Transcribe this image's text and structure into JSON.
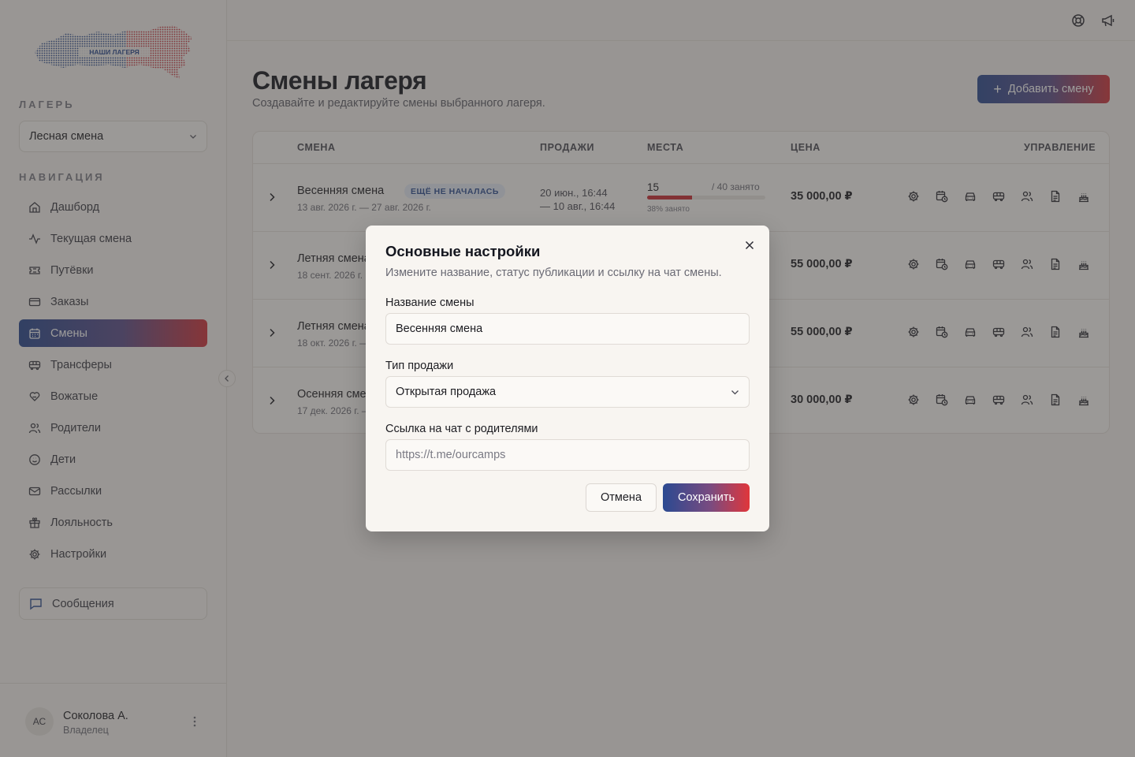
{
  "sidebar": {
    "logo_text": "НАШИ ЛАГЕРЯ",
    "camp_label": "ЛАГЕРЬ",
    "camp_value": "Лесная смена",
    "nav_label": "НАВИГАЦИЯ",
    "items": [
      {
        "label": "Дашборд",
        "icon": "home-icon"
      },
      {
        "label": "Текущая смена",
        "icon": "activity-icon"
      },
      {
        "label": "Путёвки",
        "icon": "ticket-icon"
      },
      {
        "label": "Заказы",
        "icon": "card-icon"
      },
      {
        "label": "Смены",
        "icon": "calendar-icon"
      },
      {
        "label": "Трансферы",
        "icon": "bus-icon"
      },
      {
        "label": "Вожатые",
        "icon": "heart-hand-icon"
      },
      {
        "label": "Родители",
        "icon": "users-icon"
      },
      {
        "label": "Дети",
        "icon": "smile-icon"
      },
      {
        "label": "Рассылки",
        "icon": "mail-icon"
      },
      {
        "label": "Лояльность",
        "icon": "gift-icon"
      },
      {
        "label": "Настройки",
        "icon": "gear-icon"
      }
    ],
    "active_index": 4,
    "messages_label": "Сообщения",
    "user": {
      "initials": "АС",
      "name": "Соколова А.",
      "role": "Владелец"
    }
  },
  "header": {
    "title": "Смены лагеря",
    "subtitle": "Создавайте и редактируйте смены выбранного лагеря.",
    "add_button": "Добавить смену"
  },
  "table": {
    "columns": [
      "СМЕНА",
      "ПРОДАЖИ",
      "МЕСТА",
      "ЦЕНА",
      "УПРАВЛЕНИЕ"
    ],
    "rows": [
      {
        "name": "Весенняя смена",
        "badge": "ЕЩЁ НЕ НАЧАЛАСЬ",
        "dates": "13 авг. 2026 г. — 27 авг. 2026 г.",
        "sales_from": "20 июн., 16:44",
        "sales_to": "— 10 авг., 16:44",
        "seats_taken": "15",
        "seats_total": "/ 40 занято",
        "seats_percent": "38% занято",
        "fill": 0.38,
        "price": "35 000,00 ₽"
      },
      {
        "name": "Летняя смена",
        "dates": "18 сент. 2026 г.",
        "price": "55 000,00 ₽"
      },
      {
        "name": "Летняя смена",
        "dates": "18 окт. 2026 г. —",
        "price": "55 000,00 ₽"
      },
      {
        "name": "Осенняя смена",
        "dates": "17 дек. 2026 г. —",
        "price": "30 000,00 ₽"
      }
    ]
  },
  "modal": {
    "title": "Основные настройки",
    "subtitle": "Измените название, статус публикации и ссылку на чат смены.",
    "name_label": "Название смены",
    "name_value": "Весенняя смена",
    "sale_label": "Тип продажи",
    "sale_value": "Открытая продажа",
    "chat_label": "Ссылка на чат с родителями",
    "chat_placeholder": "https://t.me/ourcamps",
    "cancel": "Отмена",
    "save": "Сохранить"
  }
}
